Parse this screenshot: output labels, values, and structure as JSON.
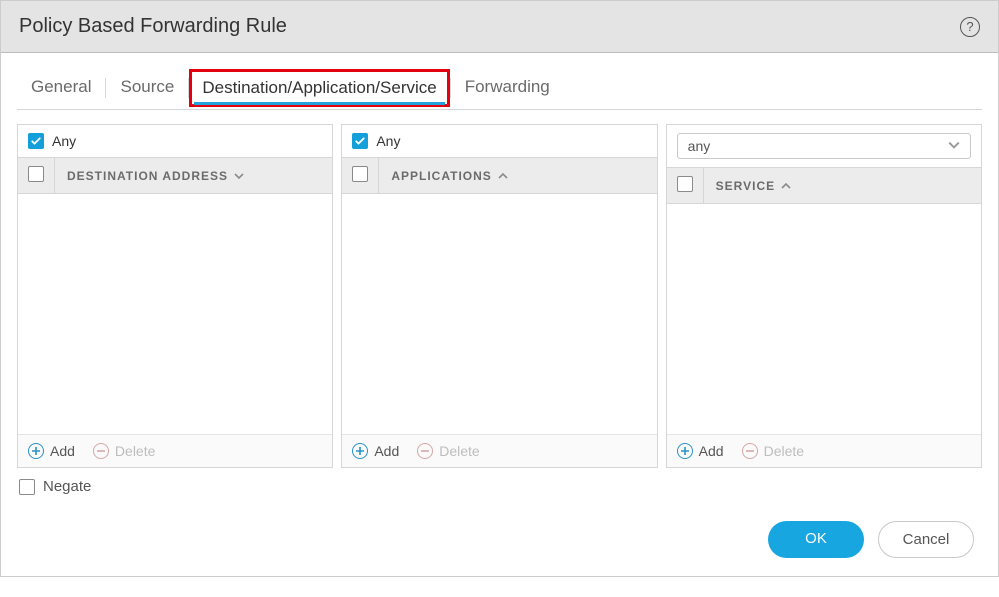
{
  "header": {
    "title": "Policy Based Forwarding Rule"
  },
  "tabs": {
    "general": "General",
    "source": "Source",
    "dest": "Destination/Application/Service",
    "forwarding": "Forwarding",
    "active": "dest"
  },
  "panels": {
    "destination": {
      "any_label": "Any",
      "any_checked": true,
      "column": "DESTINATION ADDRESS"
    },
    "applications": {
      "any_label": "Any",
      "any_checked": true,
      "column": "APPLICATIONS"
    },
    "service": {
      "select_value": "any",
      "column": "SERVICE"
    }
  },
  "buttons": {
    "add": "Add",
    "delete": "Delete",
    "ok": "OK",
    "cancel": "Cancel"
  },
  "negate": {
    "label": "Negate",
    "checked": false
  }
}
